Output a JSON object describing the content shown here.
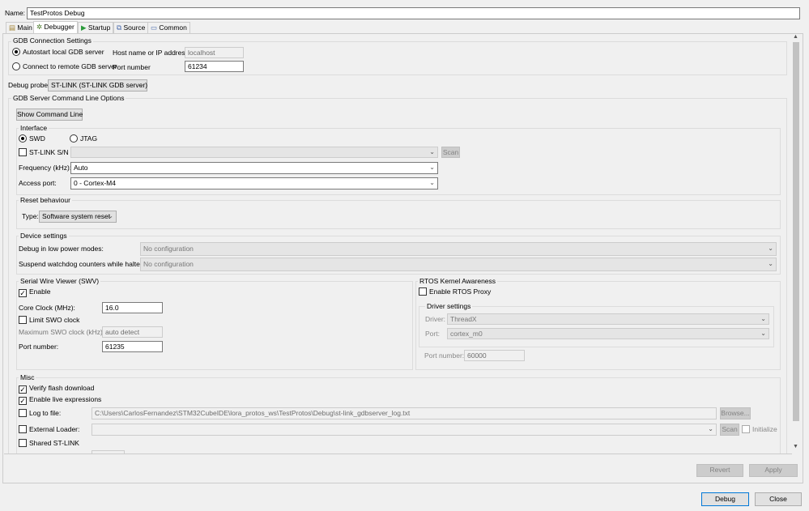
{
  "name": {
    "label": "Name:",
    "value": "TestProtos Debug"
  },
  "tabs": [
    {
      "label": "Main",
      "icon": "document-icon"
    },
    {
      "label": "Debugger",
      "icon": "bug-icon"
    },
    {
      "label": "Startup",
      "icon": "play-icon"
    },
    {
      "label": "Source",
      "icon": "source-icon"
    },
    {
      "label": "Common",
      "icon": "common-icon"
    }
  ],
  "gdb": {
    "title": "GDB Connection Settings",
    "autostart": "Autostart local GDB server",
    "connect": "Connect to remote GDB server",
    "host_label": "Host name or IP address",
    "host_value": "localhost",
    "port_label": "Port number",
    "port_value": "61234"
  },
  "probe": {
    "label": "Debug probe",
    "value": "ST-LINK (ST-LINK GDB server)"
  },
  "server": {
    "title": "GDB Server Command Line Options",
    "show_cmd": "Show Command Line"
  },
  "iface": {
    "title": "Interface",
    "swd": "SWD",
    "jtag": "JTAG",
    "sn_label": "ST-LINK S/N",
    "scan": "Scan",
    "freq_label": "Frequency (kHz):",
    "freq_value": "Auto",
    "ap_label": "Access port:",
    "ap_value": "0 - Cortex-M4"
  },
  "reset": {
    "title": "Reset behaviour",
    "type_label": "Type:",
    "type_value": "Software system reset"
  },
  "device": {
    "title": "Device settings",
    "lowpower_label": "Debug in low power modes:",
    "lowpower_value": "No configuration",
    "watchdog_label": "Suspend watchdog counters while halted:",
    "watchdog_value": "No configuration"
  },
  "swv": {
    "title": "Serial Wire Viewer (SWV)",
    "enable": "Enable",
    "core_label": "Core Clock (MHz):",
    "core_value": "16.0",
    "limit": "Limit SWO clock",
    "max_label": "Maximum SWO clock (kHz):",
    "max_value": "auto detect",
    "port_label": "Port number:",
    "port_value": "61235"
  },
  "rtos": {
    "title": "RTOS Kernel Awareness",
    "enable": "Enable RTOS Proxy",
    "driver_title": "Driver settings",
    "driver_label": "Driver:",
    "driver_value": "ThreadX",
    "port_label": "Port:",
    "port_value": "cortex_m0",
    "portnum_label": "Port number:",
    "portnum_value": "60000"
  },
  "misc": {
    "title": "Misc",
    "verify": "Verify flash download",
    "live": "Enable live expressions",
    "log_label": "Log to file:",
    "log_value": "C:\\Users\\CarlosFernandez\\STM32CubeIDE\\lora_protos_ws\\TestProtos\\Debug\\st-link_gdbserver_log.txt",
    "browse": "Browse...",
    "loader_label": "External Loader:",
    "scan": "Scan",
    "initialize": "Initialize",
    "shared": "Shared ST-LINK"
  },
  "actions": {
    "revert": "Revert",
    "apply": "Apply",
    "debug": "Debug",
    "close": "Close"
  }
}
